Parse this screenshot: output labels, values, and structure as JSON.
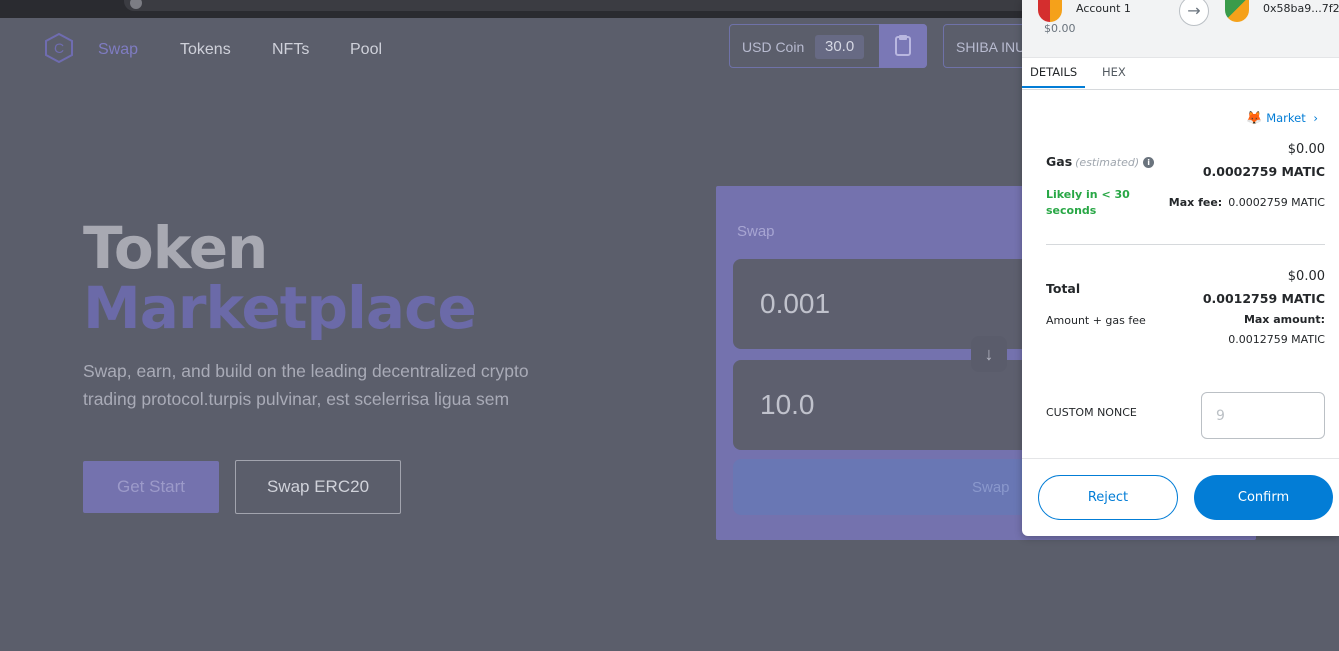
{
  "browser": {
    "tab_hint": ""
  },
  "nav": {
    "logo_letter": "C",
    "links": [
      "Swap",
      "Tokens",
      "NFTs",
      "Pool"
    ],
    "token_a": {
      "name": "USD Coin",
      "value": "30.0"
    },
    "token_b": {
      "name": "SHIBA INU"
    }
  },
  "hero": {
    "title_line1": "Token",
    "title_line2": "Marketplace",
    "subtitle": "Swap, earn, and build on the leading decentralized crypto trading protocol.turpis pulvinar, est scelerrisa ligua sem",
    "get_start_label": "Get Start",
    "swap_erc20_label": "Swap ERC20"
  },
  "swap_card": {
    "title": "Swap",
    "from_value": "0.001",
    "to_value": "10.0",
    "arrow_glyph": "↓",
    "button_label": "Swap"
  },
  "metamask": {
    "header": {
      "account_name": "Account 1",
      "account_value": "$0.00",
      "arrow_glyph": "→",
      "recipient_address": "0x58ba9...7f2..."
    },
    "tabs": [
      "DETAILS",
      "HEX"
    ],
    "market_label": "Market",
    "market_chevron": "›",
    "gas": {
      "label": "Gas",
      "estimated": "(estimated)",
      "info_glyph": "i",
      "usd": "$0.00",
      "matic": "0.0002759 MATIC",
      "likely": "Likely in < 30 seconds",
      "max_fee_label": "Max fee:",
      "max_fee_value": "0.0002759 MATIC"
    },
    "total": {
      "label": "Total",
      "usd": "$0.00",
      "matic": "0.0012759 MATIC",
      "amount_gas_label": "Amount + gas fee",
      "max_amount_label": "Max amount:",
      "max_amount_value": "0.0012759 MATIC"
    },
    "nonce": {
      "label": "CUSTOM NONCE",
      "placeholder": "9"
    },
    "reject_label": "Reject",
    "confirm_label": "Confirm"
  },
  "colors": {
    "page_bg": "#5b5e6b",
    "accent_purple": "#7472ae",
    "metamask_blue": "#037dd6",
    "success_green": "#28a745"
  }
}
